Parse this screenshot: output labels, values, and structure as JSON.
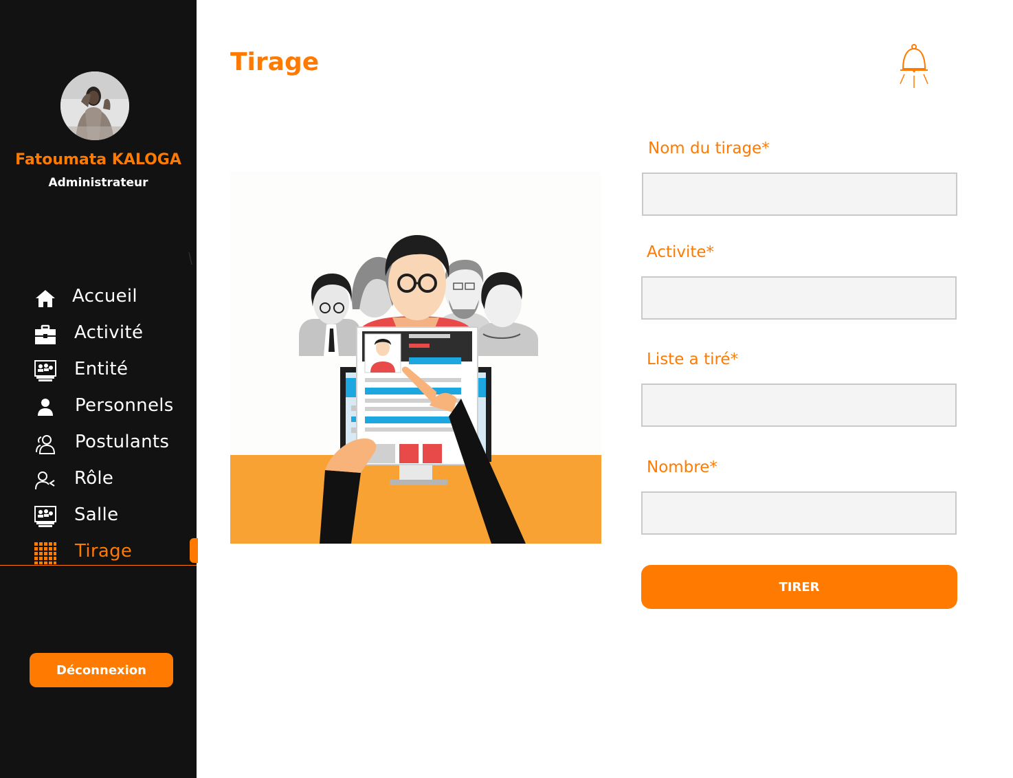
{
  "user": {
    "name": "Fatoumata KALOGA",
    "role": "Administrateur"
  },
  "sidebar": {
    "items": [
      {
        "label": "Accueil",
        "icon": "home-icon"
      },
      {
        "label": "Activité",
        "icon": "briefcase-icon"
      },
      {
        "label": "Entité",
        "icon": "classroom-icon"
      },
      {
        "label": "Personnels",
        "icon": "person-icon"
      },
      {
        "label": "Postulants",
        "icon": "users-outline-icon"
      },
      {
        "label": "Rôle",
        "icon": "user-role-icon"
      },
      {
        "label": "Salle",
        "icon": "classroom-icon"
      },
      {
        "label": "Tirage",
        "icon": "grid-icon"
      }
    ],
    "active": "Tirage",
    "logout_label": "Déconnexion"
  },
  "header": {
    "title": "Tirage",
    "notification_icon": "bell-icon"
  },
  "form": {
    "fields": [
      {
        "label": "Nom du tirage*",
        "value": ""
      },
      {
        "label": "Activite*",
        "value": ""
      },
      {
        "label": "Liste a tiré*",
        "value": ""
      },
      {
        "label": "Nombre*",
        "value": ""
      }
    ],
    "submit_label": "TIRER"
  },
  "colors": {
    "accent": "#ff7a00",
    "sidebar_bg": "#121212",
    "input_bg": "#f4f4f4",
    "input_border": "#c9c9c9",
    "illustration_desk": "#f7a233"
  }
}
